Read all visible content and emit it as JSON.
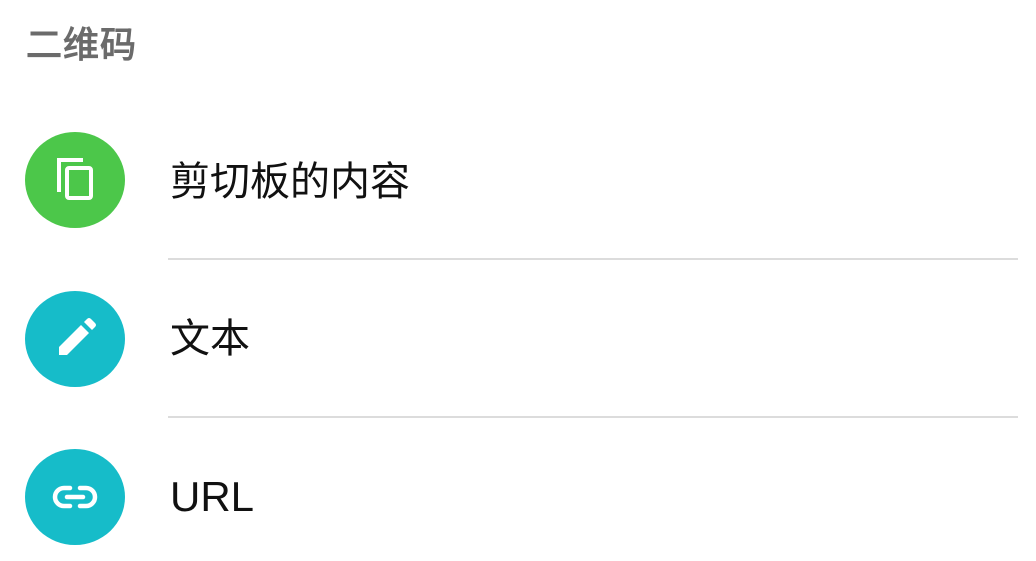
{
  "section": {
    "title": "二维码"
  },
  "items": [
    {
      "label": "剪切板的内容",
      "icon": "copy-icon",
      "color": "#4cc74a"
    },
    {
      "label": "文本",
      "icon": "pencil-icon",
      "color": "#16bcc9"
    },
    {
      "label": "URL",
      "icon": "link-icon",
      "color": "#16bcc9"
    }
  ]
}
